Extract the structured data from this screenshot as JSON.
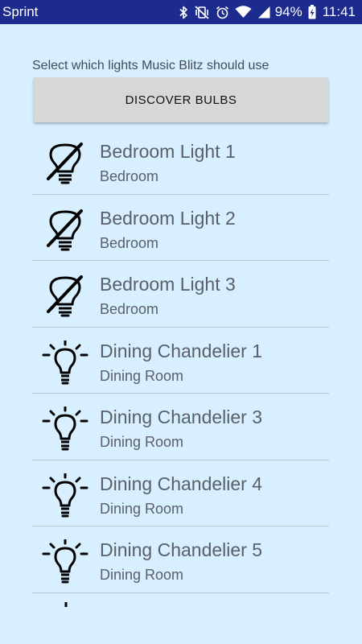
{
  "status_bar": {
    "carrier": "Sprint",
    "battery_percent": "94%",
    "time": "11:41",
    "icons": [
      "bluetooth-icon",
      "vibrate-mute-icon",
      "alarm-icon",
      "wifi-icon",
      "signal-icon",
      "battery-charging-icon"
    ]
  },
  "header": {
    "instruction": "Select which lights Music Blitz should use"
  },
  "actions": {
    "discover_label": "DISCOVER BULBS"
  },
  "bulbs": [
    {
      "name": "Bedroom Light 1",
      "room": "Bedroom",
      "icon": "bulb-disabled-icon"
    },
    {
      "name": "Bedroom Light 2",
      "room": "Bedroom",
      "icon": "bulb-disabled-icon"
    },
    {
      "name": "Bedroom Light 3",
      "room": "Bedroom",
      "icon": "bulb-disabled-icon"
    },
    {
      "name": "Dining Chandelier 1",
      "room": "Dining Room",
      "icon": "bulb-on-icon"
    },
    {
      "name": "Dining Chandelier 3",
      "room": "Dining Room",
      "icon": "bulb-on-icon"
    },
    {
      "name": "Dining Chandelier 4",
      "room": "Dining Room",
      "icon": "bulb-on-icon"
    },
    {
      "name": "Dining Chandelier 5",
      "room": "Dining Room",
      "icon": "bulb-on-icon"
    }
  ],
  "colors": {
    "status_bar": "#1d2a8e",
    "background": "#d7efff",
    "button": "#d6d7d7",
    "text": "#596068",
    "divider": "#bcc8d0"
  }
}
